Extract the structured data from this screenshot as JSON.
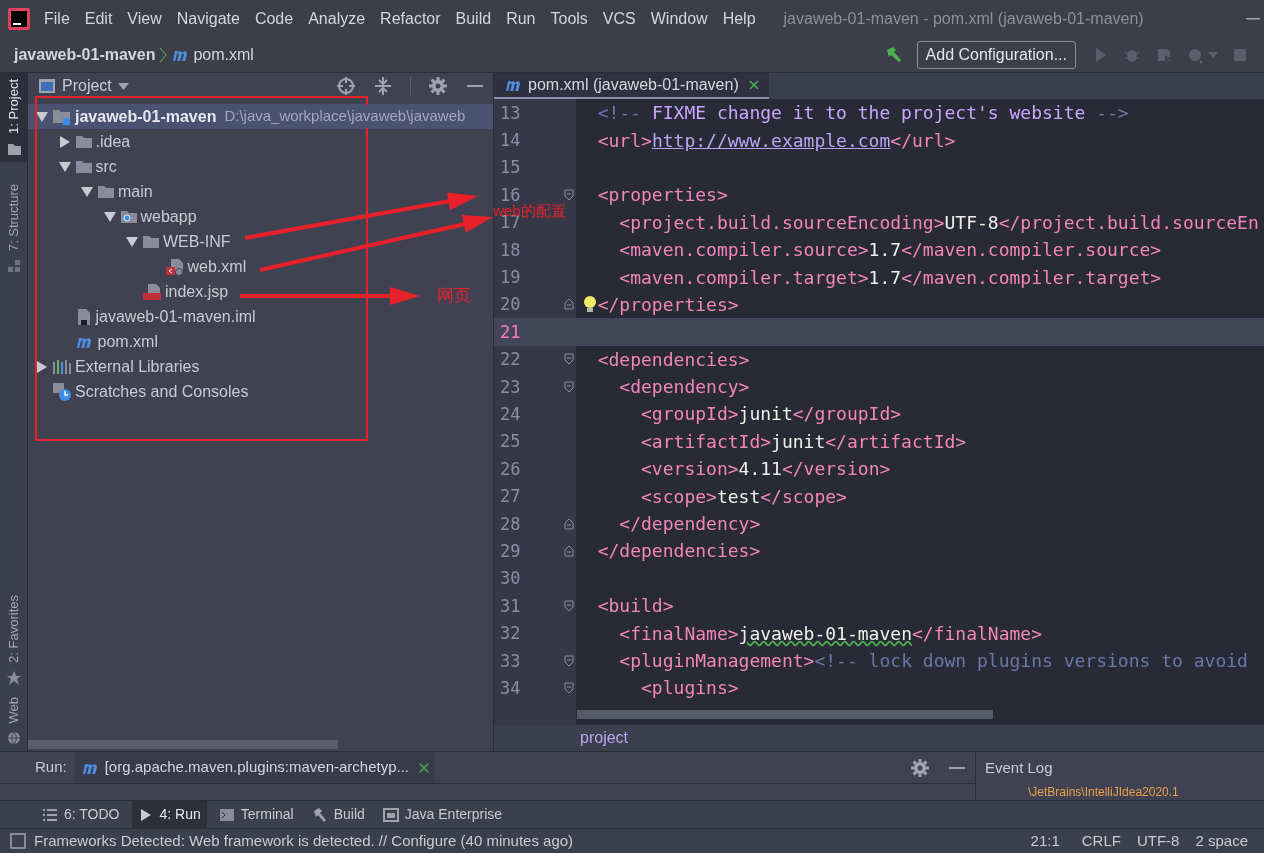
{
  "menu_bar": {
    "items": [
      "File",
      "Edit",
      "View",
      "Navigate",
      "Code",
      "Analyze",
      "Refactor",
      "Build",
      "Run",
      "Tools",
      "VCS",
      "Window",
      "Help"
    ],
    "title": "javaweb-01-maven - pom.xml (javaweb-01-maven)"
  },
  "nav_bar": {
    "breadcrumb": [
      {
        "kind": "project",
        "text": "javaweb-01-maven"
      },
      {
        "kind": "maven",
        "text": "pom.xml"
      }
    ],
    "run_config": "Add Configuration...",
    "tools": [
      {
        "kind": "build"
      },
      {
        "kind": "run"
      },
      {
        "kind": "debug"
      },
      {
        "kind": "coverage"
      },
      {
        "kind": "profile"
      },
      {
        "kind": "stop"
      }
    ]
  },
  "left_stripe": {
    "tabs": [
      {
        "kind": "project",
        "label": "1: Project",
        "selected": true
      },
      {
        "kind": "structure",
        "label": "7: Structure",
        "selected": false
      },
      {
        "kind": "favorites",
        "label": "2: Favorites",
        "selected": false
      },
      {
        "kind": "web",
        "label": "Web",
        "selected": false
      }
    ]
  },
  "project_panel": {
    "title": "Project",
    "tree": [
      {
        "label": "javaweb-01-maven",
        "kind": "module",
        "expanded": true,
        "selected": true,
        "note": "D:\\java_workplace\\javaweb\\javaweb",
        "children": [
          {
            "label": ".idea",
            "kind": "folder",
            "expanded": false,
            "selected": false
          },
          {
            "label": "src",
            "kind": "folder",
            "expanded": true,
            "selected": false,
            "children": [
              {
                "label": "main",
                "kind": "folder",
                "expanded": true,
                "selected": false,
                "children": [
                  {
                    "label": "webapp",
                    "kind": "webfolder",
                    "expanded": true,
                    "selected": false,
                    "children": [
                      {
                        "label": "WEB-INF",
                        "kind": "folder",
                        "expanded": true,
                        "selected": false,
                        "children": [
                          {
                            "label": "web.xml",
                            "kind": "webxml",
                            "selected": false
                          }
                        ]
                      },
                      {
                        "label": "index.jsp",
                        "kind": "jsp",
                        "selected": false
                      }
                    ]
                  }
                ]
              }
            ]
          },
          {
            "label": "javaweb-01-maven.iml",
            "kind": "iml",
            "selected": false
          },
          {
            "label": "pom.xml",
            "kind": "maven",
            "selected": false
          }
        ]
      },
      {
        "label": "External Libraries",
        "kind": "libraries",
        "expanded": false,
        "selected": false
      },
      {
        "label": "Scratches and Consoles",
        "kind": "scratches",
        "selected": false
      }
    ]
  },
  "editor": {
    "tab": {
      "label": "pom.xml (javaweb-01-maven)",
      "selected": true
    },
    "breadcrumb": "project",
    "lines": [
      {
        "n": "13",
        "current": false,
        "tokens": [
          {
            "kind": "comment",
            "text": "  <!-- "
          },
          {
            "kind": "todo",
            "text": "FIXME change it to the project's website"
          },
          {
            "kind": "comment",
            "text": " -->"
          }
        ]
      },
      {
        "n": "14",
        "current": false,
        "tokens": [
          {
            "kind": "tag",
            "text": "  <url>"
          },
          {
            "kind": "link",
            "text": "http://www.example.com"
          },
          {
            "kind": "tag",
            "text": "</url>"
          }
        ]
      },
      {
        "n": "15",
        "current": false
      },
      {
        "n": "16",
        "current": false,
        "fold_start": true,
        "tokens": [
          {
            "kind": "tag",
            "text": "  <properties>"
          }
        ]
      },
      {
        "n": "17",
        "current": false,
        "tokens": [
          {
            "kind": "tag",
            "text": "    <project.build.sourceEncoding>"
          },
          {
            "kind": "text",
            "text": "UTF-8"
          },
          {
            "kind": "tag",
            "text": "</project.build.sourceEn"
          }
        ]
      },
      {
        "n": "18",
        "current": false,
        "tokens": [
          {
            "kind": "tag",
            "text": "    <maven.compiler.source>"
          },
          {
            "kind": "text",
            "text": "1.7"
          },
          {
            "kind": "tag",
            "text": "</maven.compiler.source>"
          }
        ]
      },
      {
        "n": "19",
        "current": false,
        "tokens": [
          {
            "kind": "tag",
            "text": "    <maven.compiler.target>"
          },
          {
            "kind": "text",
            "text": "1.7"
          },
          {
            "kind": "tag",
            "text": "</maven.compiler.target>"
          }
        ]
      },
      {
        "n": "20",
        "current": false,
        "fold_end": true,
        "bulb": true,
        "tokens": [
          {
            "kind": "tag",
            "text": "  </properties>"
          }
        ]
      },
      {
        "n": "21",
        "current": true
      },
      {
        "n": "22",
        "current": false,
        "fold_start": true,
        "tokens": [
          {
            "kind": "tag",
            "text": "  <dependencies>"
          }
        ]
      },
      {
        "n": "23",
        "current": false,
        "fold_start": true,
        "tokens": [
          {
            "kind": "tag",
            "text": "    <dependency>"
          }
        ]
      },
      {
        "n": "24",
        "current": false,
        "tokens": [
          {
            "kind": "tag",
            "text": "      <groupId>"
          },
          {
            "kind": "text",
            "text": "junit"
          },
          {
            "kind": "tag",
            "text": "</groupId>"
          }
        ]
      },
      {
        "n": "25",
        "current": false,
        "tokens": [
          {
            "kind": "tag",
            "text": "      <artifactId>"
          },
          {
            "kind": "text",
            "text": "junit"
          },
          {
            "kind": "tag",
            "text": "</artifactId>"
          }
        ]
      },
      {
        "n": "26",
        "current": false,
        "tokens": [
          {
            "kind": "tag",
            "text": "      <version>"
          },
          {
            "kind": "text",
            "text": "4.11"
          },
          {
            "kind": "tag",
            "text": "</version>"
          }
        ]
      },
      {
        "n": "27",
        "current": false,
        "tokens": [
          {
            "kind": "tag",
            "text": "      <scope>"
          },
          {
            "kind": "text",
            "text": "test"
          },
          {
            "kind": "tag",
            "text": "</scope>"
          }
        ]
      },
      {
        "n": "28",
        "current": false,
        "fold_end": true,
        "tokens": [
          {
            "kind": "tag",
            "text": "    </dependency>"
          }
        ]
      },
      {
        "n": "29",
        "current": false,
        "fold_end": true,
        "tokens": [
          {
            "kind": "tag",
            "text": "  </dependencies>"
          }
        ]
      },
      {
        "n": "30",
        "current": false
      },
      {
        "n": "31",
        "current": false,
        "fold_start": true,
        "tokens": [
          {
            "kind": "tag",
            "text": "  <build>"
          }
        ]
      },
      {
        "n": "32",
        "current": false,
        "tokens": [
          {
            "kind": "tag",
            "text": "    <finalName>"
          },
          {
            "kind": "typo",
            "text": "javaweb-01-maven"
          },
          {
            "kind": "tag",
            "text": "</finalName>"
          }
        ]
      },
      {
        "n": "33",
        "current": false,
        "fold_start": true,
        "tokens": [
          {
            "kind": "tag",
            "text": "    <pluginManagement>"
          },
          {
            "kind": "comment",
            "text": "<!-- lock down plugins versions to avoid"
          }
        ]
      },
      {
        "n": "34",
        "current": false,
        "fold_start": true,
        "tokens": [
          {
            "kind": "tag",
            "text": "      <plugins>"
          }
        ]
      }
    ]
  },
  "run_panel": {
    "label": "Run:",
    "tab": "[org.apache.maven.plugins:maven-archetyp..."
  },
  "event_log": {
    "title": "Event Log",
    "line": "\\JetBrains\\IntelliJIdea2020.1"
  },
  "tool_bar": [
    {
      "kind": "todo",
      "label": "6: TODO",
      "selected": false
    },
    {
      "kind": "run",
      "label": "4: Run",
      "selected": true
    },
    {
      "kind": "terminal",
      "label": "Terminal",
      "selected": false
    },
    {
      "kind": "build",
      "label": "Build",
      "selected": false
    },
    {
      "kind": "enterprise",
      "label": "Java Enterprise",
      "selected": false
    }
  ],
  "status_bar": {
    "message": "Frameworks Detected: Web framework is detected. // Configure (40 minutes ago)",
    "items": [
      "21:1",
      "CRLF",
      "UTF-8",
      "2 space"
    ]
  },
  "annotations": {
    "labels": [
      "web的配置",
      "网页"
    ]
  }
}
